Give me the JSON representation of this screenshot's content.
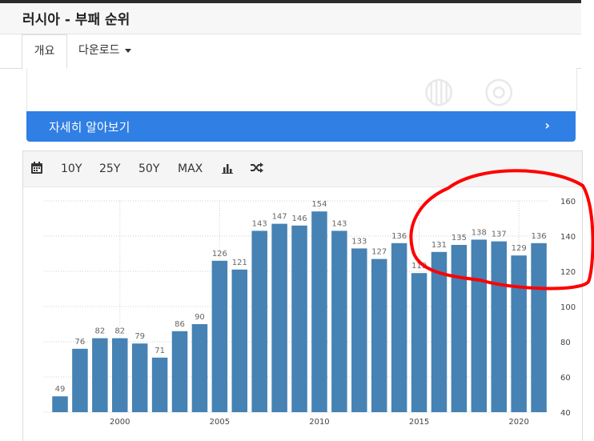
{
  "page": {
    "title": "러시아 - 부패 순위"
  },
  "tabs": {
    "overview": "개요",
    "download": "다운로드"
  },
  "banner": {
    "label": "자세히 알아보기",
    "chevron": "›"
  },
  "toolbar": {
    "calendar_icon": "calendar-icon",
    "ranges": [
      "10Y",
      "25Y",
      "50Y",
      "MAX"
    ],
    "bar_chart_icon": "bar-chart-icon",
    "shuffle_icon": "shuffle-icon"
  },
  "colors": {
    "bar": "#4682b4",
    "banner": "#2f7fe5",
    "annotation": "#ff0000"
  },
  "chart_data": {
    "type": "bar",
    "categories": [
      "1997",
      "1998",
      "1999",
      "2000",
      "2001",
      "2002",
      "2003",
      "2004",
      "2005",
      "2006",
      "2007",
      "2008",
      "2009",
      "2010",
      "2011",
      "2012",
      "2013",
      "2014",
      "2015",
      "2016",
      "2017",
      "2018",
      "2019",
      "2020",
      "2021"
    ],
    "values": [
      49,
      76,
      82,
      82,
      79,
      71,
      86,
      90,
      126,
      121,
      143,
      147,
      146,
      154,
      143,
      133,
      127,
      136,
      119,
      131,
      135,
      138,
      137,
      129,
      136
    ],
    "value_labels": [
      "49",
      "76",
      "82",
      "82",
      "79",
      "71",
      "86",
      "90",
      "126",
      "121",
      "143",
      "147",
      "146",
      "154",
      "143",
      "133",
      "127",
      "136",
      "119",
      "131",
      "135",
      "138",
      "137",
      "129",
      "136"
    ],
    "y_ticks": [
      "160",
      "140",
      "120",
      "100",
      "80",
      "60",
      "40"
    ],
    "x_ticks": [
      "2000",
      "2005",
      "2010",
      "2015",
      "2020"
    ],
    "ylim": [
      40,
      160
    ],
    "grid": true,
    "y_axis_position": "right",
    "annotation": "hand-drawn red circle around 2015-2021 bars"
  }
}
